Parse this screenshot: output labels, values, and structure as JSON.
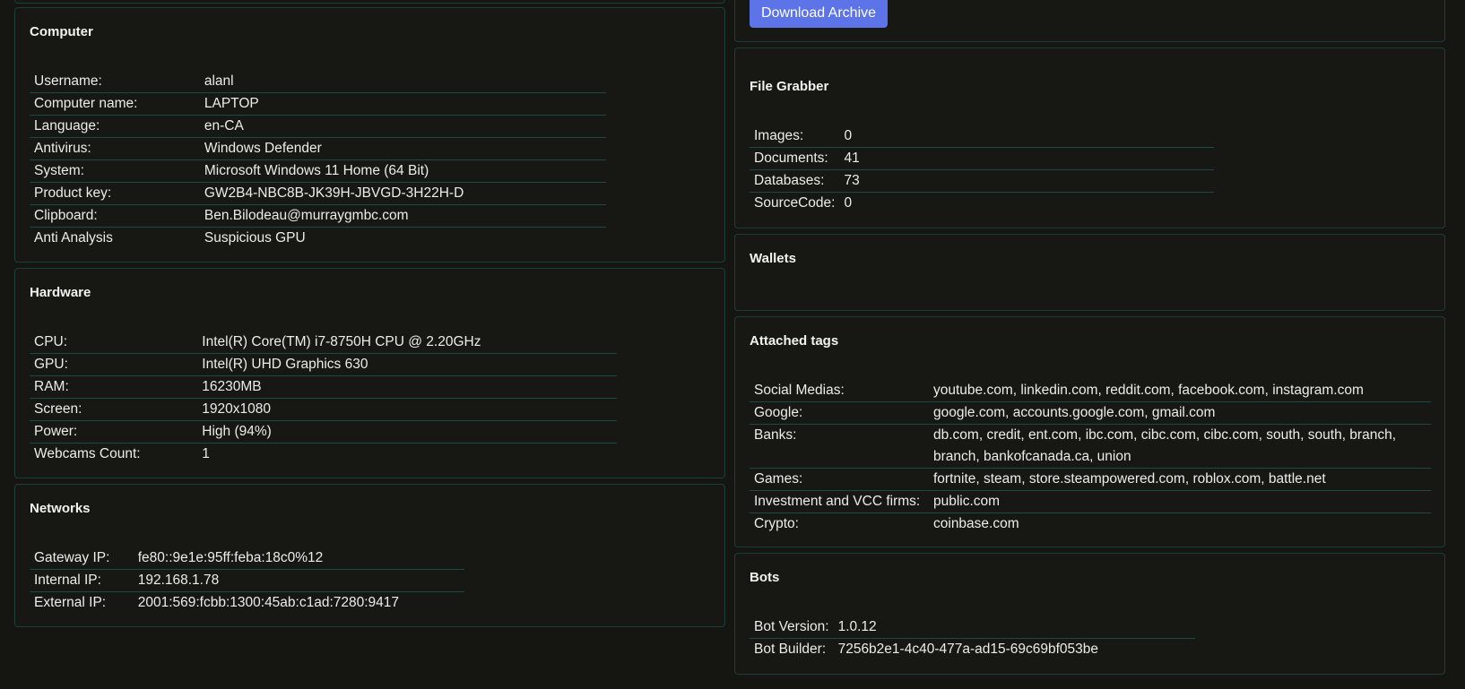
{
  "download_button": "Download Archive",
  "computer": {
    "title": "Computer",
    "rows": [
      {
        "label": "Username:",
        "value": "alanl"
      },
      {
        "label": "Computer name:",
        "value": "LAPTOP"
      },
      {
        "label": "Language:",
        "value": "en-CA"
      },
      {
        "label": "Antivirus:",
        "value": "Windows Defender"
      },
      {
        "label": "System:",
        "value": "Microsoft Windows 11 Home (64 Bit)"
      },
      {
        "label": "Product key:",
        "value": "GW2B4-NBC8B-JK39H-JBVGD-3H22H-D"
      },
      {
        "label": "Clipboard:",
        "value": "Ben.Bilodeau@murraygmbc.com"
      },
      {
        "label": "Anti Analysis",
        "value": "Suspicious GPU"
      }
    ]
  },
  "hardware": {
    "title": "Hardware",
    "rows": [
      {
        "label": "CPU:",
        "value": "Intel(R) Core(TM) i7-8750H CPU @ 2.20GHz"
      },
      {
        "label": "GPU:",
        "value": "Intel(R) UHD Graphics 630"
      },
      {
        "label": "RAM:",
        "value": "16230MB"
      },
      {
        "label": "Screen:",
        "value": "1920x1080"
      },
      {
        "label": "Power:",
        "value": "High (94%)"
      },
      {
        "label": "Webcams Count:",
        "value": "1"
      }
    ]
  },
  "networks": {
    "title": "Networks",
    "rows": [
      {
        "label": "Gateway IP:",
        "value": "fe80::9e1e:95ff:feba:18c0%12"
      },
      {
        "label": "Internal IP:",
        "value": "192.168.1.78"
      },
      {
        "label": "External IP:",
        "value": "2001:569:fcbb:1300:45ab:c1ad:7280:9417"
      }
    ]
  },
  "file_grabber": {
    "title": "File Grabber",
    "rows": [
      {
        "label": "Images:",
        "value": "0"
      },
      {
        "label": "Documents:",
        "value": "41"
      },
      {
        "label": "Databases:",
        "value": "73"
      },
      {
        "label": "SourceCode:",
        "value": "0"
      }
    ]
  },
  "wallets": {
    "title": "Wallets"
  },
  "attached_tags": {
    "title": "Attached tags",
    "rows": [
      {
        "label": "Social Medias:",
        "value": "youtube.com, linkedin.com, reddit.com, facebook.com, instagram.com"
      },
      {
        "label": "Google:",
        "value": "google.com, accounts.google.com, gmail.com"
      },
      {
        "label": "Banks:",
        "value": "db.com, credit, ent.com, ibc.com, cibc.com, cibc.com, south, south, branch, branch, bankofcanada.ca, union"
      },
      {
        "label": "Games:",
        "value": "fortnite, steam, store.steampowered.com, roblox.com, battle.net"
      },
      {
        "label": "Investment and VCC firms:",
        "value": "public.com"
      },
      {
        "label": "Crypto:",
        "value": "coinbase.com"
      }
    ]
  },
  "bots": {
    "title": "Bots",
    "rows": [
      {
        "label": "Bot Version:",
        "value": "1.0.12"
      },
      {
        "label": "Bot Builder:",
        "value": "7256b2e1-4c40-477a-ad15-69c69bf053be"
      }
    ]
  }
}
